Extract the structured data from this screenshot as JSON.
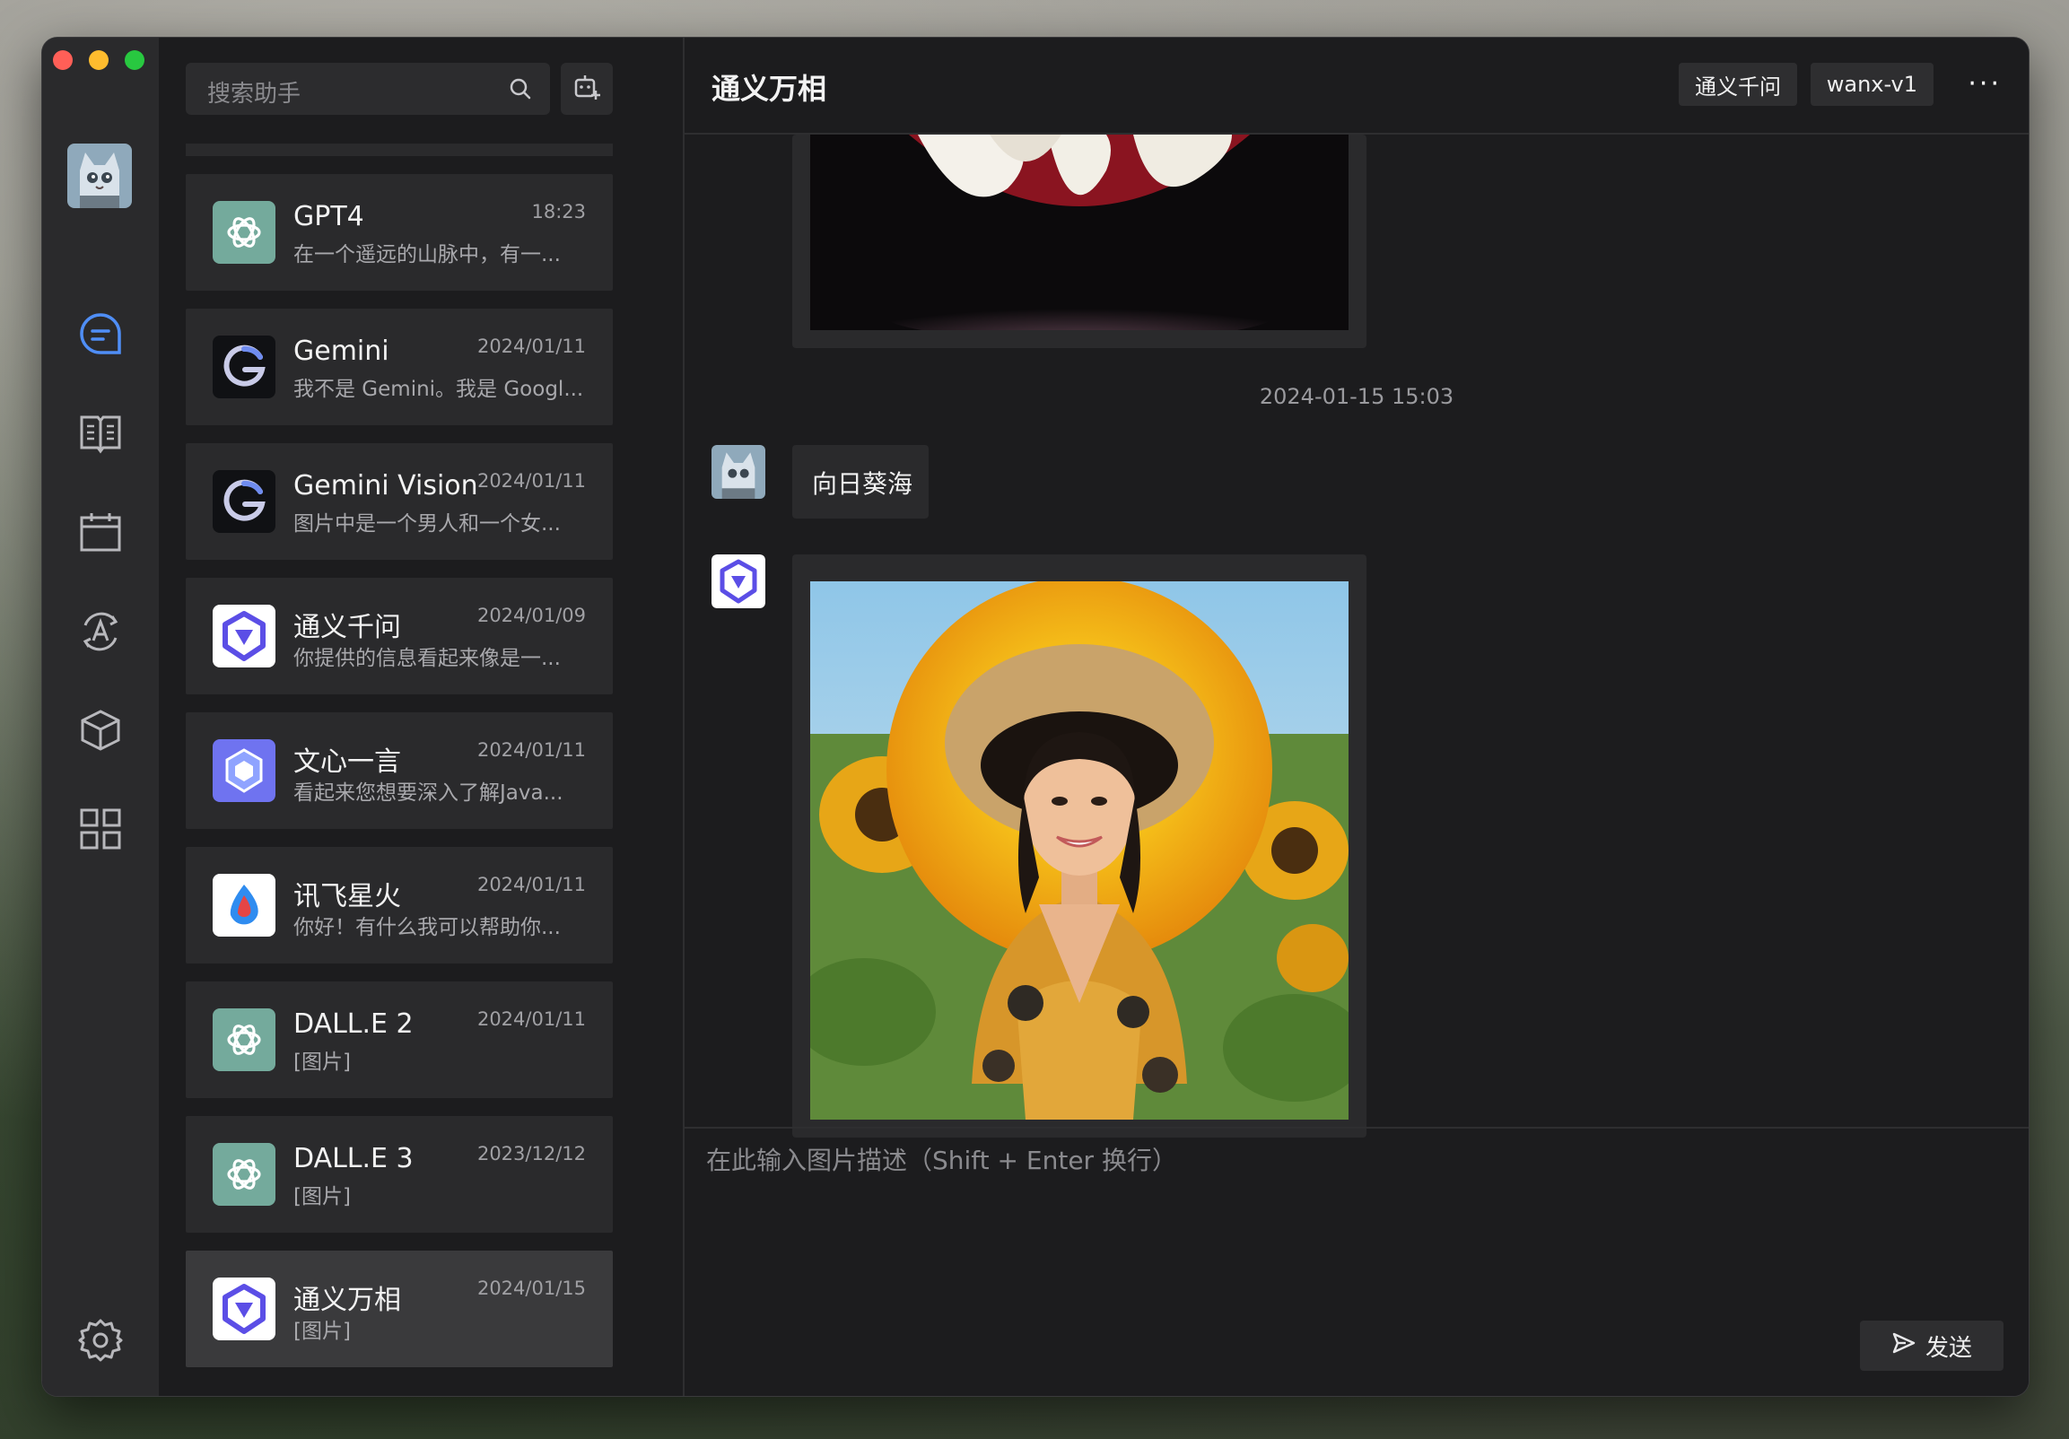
{
  "search": {
    "placeholder": "搜索助手"
  },
  "chats": [
    {
      "name": "GPT4",
      "date": "18:23",
      "preview": "在一个遥远的山脉中，有一...",
      "logo": "openai"
    },
    {
      "name": "Gemini",
      "date": "2024/01/11",
      "preview": "我不是 Gemini。我是 Googl...",
      "logo": "google"
    },
    {
      "name": "Gemini Vision",
      "date": "2024/01/11",
      "preview": "图片中是一个男人和一个女...",
      "logo": "google"
    },
    {
      "name": "通义千问",
      "date": "2024/01/09",
      "preview": "你提供的信息看起来像是一...",
      "logo": "tongyi"
    },
    {
      "name": "文心一言",
      "date": "2024/01/11",
      "preview": "看起来您想要深入了解Java...",
      "logo": "wenxin"
    },
    {
      "name": "讯飞星火",
      "date": "2024/01/11",
      "preview": "你好！有什么我可以帮助你...",
      "logo": "spark"
    },
    {
      "name": "DALL.E 2",
      "date": "2024/01/11",
      "preview": "[图片]",
      "logo": "openai"
    },
    {
      "name": "DALL.E 3",
      "date": "2023/12/12",
      "preview": "[图片]",
      "logo": "openai"
    },
    {
      "name": "通义万相",
      "date": "2024/01/15",
      "preview": "[图片]",
      "logo": "tongyi",
      "active": true
    }
  ],
  "header": {
    "title": "通义万相",
    "provider_tag": "通义千问",
    "model_tag": "wanx-v1",
    "more": "···"
  },
  "messages": {
    "timestamp": "2024-01-15 15:03",
    "user_text": "向日葵海"
  },
  "composer": {
    "placeholder": "在此输入图片描述（Shift + Enter 换行）",
    "send_label": "发送"
  }
}
